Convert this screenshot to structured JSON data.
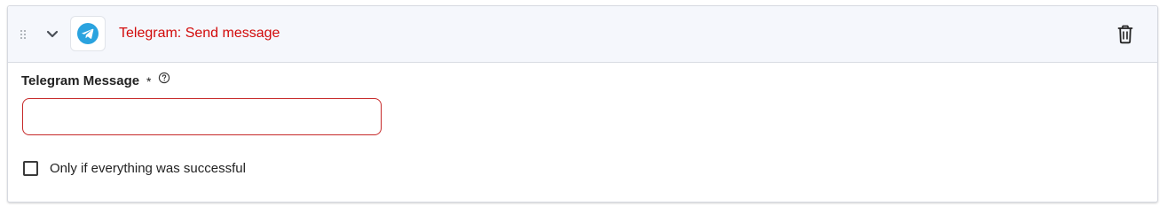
{
  "step": {
    "title": "Telegram: Send message",
    "app_icon": "telegram-icon",
    "collapse_icon": "chevron-down-icon",
    "delete_icon": "trash-icon",
    "drag_icon": "drag-handle-icon"
  },
  "form": {
    "message_field": {
      "label": "Telegram Message",
      "required_marker": "*",
      "help_icon": "help-circle-icon",
      "value": "",
      "placeholder": ""
    },
    "success_only_checkbox": {
      "label": "Only if everything was successful",
      "checked": false
    }
  },
  "colors": {
    "title": "#d20a0a",
    "error_border": "#c62828",
    "header_background": "#f5f7fc",
    "telegram_blue": "#2aa3df"
  }
}
